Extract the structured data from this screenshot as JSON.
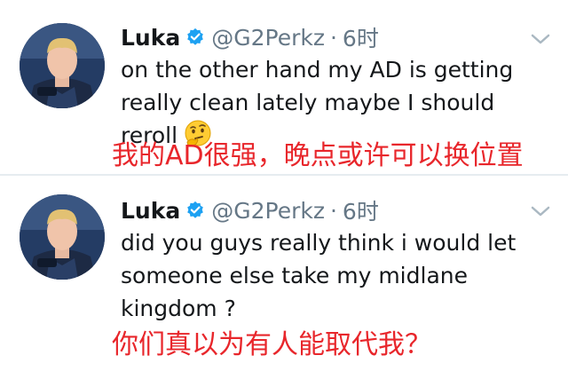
{
  "tweets": [
    {
      "name": "Luka",
      "handle": "@G2Perkz",
      "dot": "·",
      "time": "6时",
      "text": "on the other hand my AD is getting really clean lately maybe I should reroll",
      "emoji": "thinking-face-emoji",
      "caption": "我的AD很强，晚点或许可以换位置"
    },
    {
      "name": "Luka",
      "handle": "@G2Perkz",
      "dot": "·",
      "time": "6时",
      "text": "did you guys really think i would let someone else take my midlane kingdom ?",
      "caption": "你们真以为有人能取代我？"
    }
  ],
  "colors": {
    "verified": "#1da1f2",
    "caption": "#e8262b",
    "secondary_text": "#657786",
    "divider": "#e6ecf0"
  },
  "icons": [
    "verified-badge-icon",
    "chevron-down-icon"
  ]
}
